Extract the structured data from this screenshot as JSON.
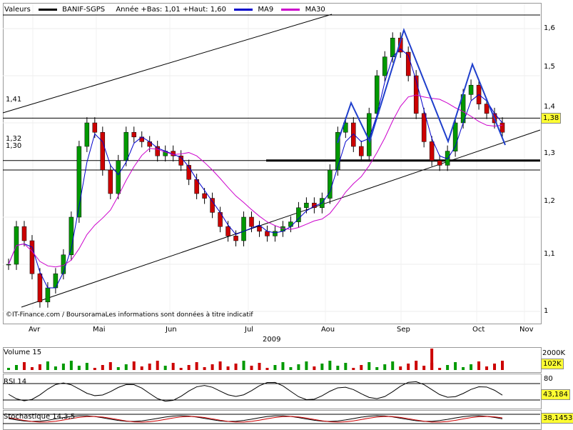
{
  "legend": {
    "prefix": "Valeurs",
    "security": "BANIF-SGPS",
    "year_info": "Année +Bas: 1,01 +Haut: 1,60",
    "ma9": "MA9",
    "ma30": "MA30",
    "colors": {
      "price": "#000000",
      "ma9": "#0000cc",
      "ma30": "#cc00cc",
      "up": "#009900",
      "down": "#cc0000",
      "support": "#000000",
      "zigzag": "#1f3fcc"
    }
  },
  "watermark": "©IT-Finance.com / BoursoramaLes informations sont données à titre indicatif",
  "year_label": "2009",
  "months": [
    "Avr",
    "Mai",
    "Jun",
    "Jul",
    "Aou",
    "Sep",
    "Oct",
    "Nov"
  ],
  "price_axis": {
    "ticks": [
      "1,6",
      "1,5",
      "1,4",
      "1,3",
      "1,2",
      "1,1",
      "1"
    ],
    "ylim": [
      1.0,
      1.64
    ]
  },
  "level_labels": [
    "1,41",
    "1,32",
    "1,30"
  ],
  "last_price": "1,38",
  "volume": {
    "label": "Volume 15",
    "ticks": [
      "2000K"
    ],
    "last": "102K"
  },
  "rsi": {
    "label": "RSI 14",
    "ticks": [
      "80"
    ],
    "last": "43,184"
  },
  "stoch": {
    "label": "Stochastique 14,3,5",
    "last": "38,1453"
  },
  "chart_data": {
    "type": "candlestick",
    "title": "BANIF-SGPS",
    "x_months": [
      "Avr",
      "Mai",
      "Jun",
      "Jul",
      "Aou",
      "Sep",
      "Oct",
      "Nov"
    ],
    "ylim": [
      1.0,
      1.64
    ],
    "horizontal_levels": [
      1.41,
      1.32,
      1.3
    ],
    "close_series": [
      1.1,
      1.18,
      1.15,
      1.08,
      1.02,
      1.05,
      1.08,
      1.12,
      1.2,
      1.35,
      1.4,
      1.38,
      1.3,
      1.25,
      1.32,
      1.38,
      1.37,
      1.36,
      1.35,
      1.33,
      1.34,
      1.33,
      1.31,
      1.28,
      1.25,
      1.24,
      1.21,
      1.18,
      1.16,
      1.15,
      1.2,
      1.18,
      1.17,
      1.16,
      1.17,
      1.18,
      1.19,
      1.22,
      1.23,
      1.22,
      1.24,
      1.3,
      1.38,
      1.4,
      1.35,
      1.33,
      1.42,
      1.5,
      1.54,
      1.58,
      1.55,
      1.5,
      1.42,
      1.36,
      1.32,
      1.31,
      1.34,
      1.4,
      1.46,
      1.48,
      1.44,
      1.42,
      1.4,
      1.38
    ],
    "last": 1.38
  }
}
